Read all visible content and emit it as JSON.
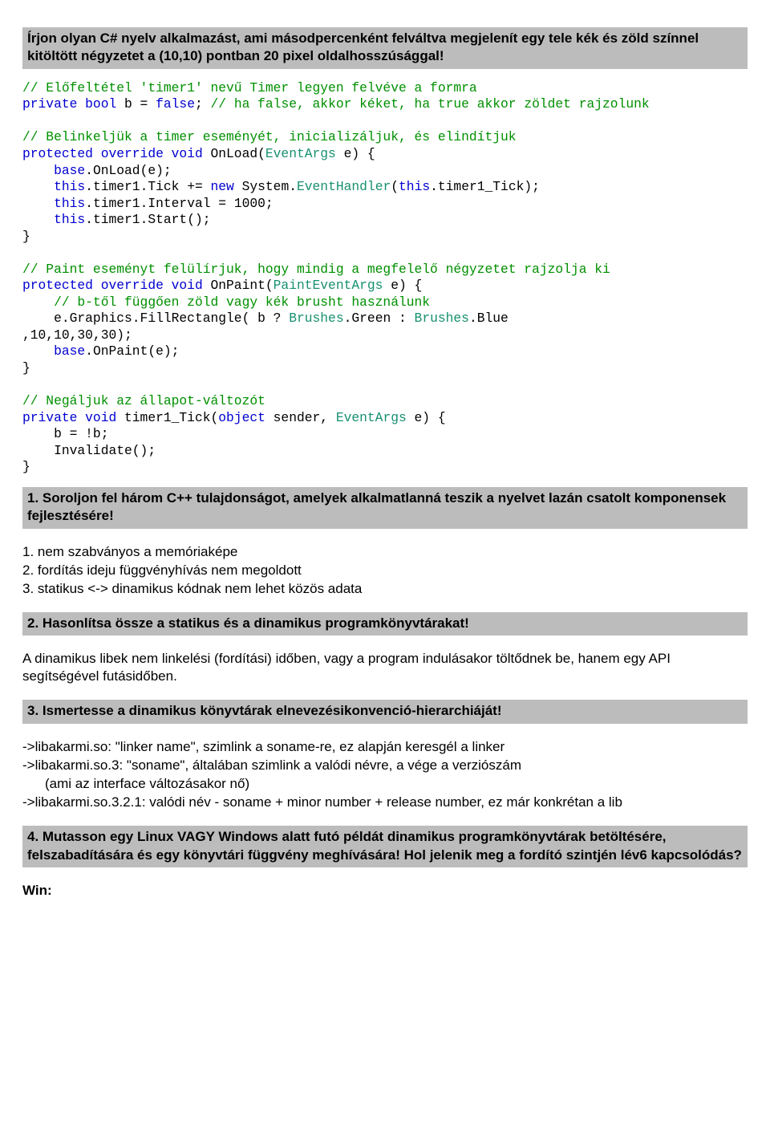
{
  "q1": {
    "title": "Írjon olyan C# nyelv alkalmazást, ami másodpercenként felváltva megjelenít egy tele kék és zöld színnel kitöltött négyzetet a (10,10) pontban 20 pixel oldalhosszúsággal!"
  },
  "code1": {
    "c1a": "// Előfeltétel 'timer1' nevű Timer legyen felvéve a formra",
    "c1b_pre": "private bool",
    "c1b_mid": " b = ",
    "c1b_false": "false",
    "c1b_post": "; ",
    "c1c": "// ha false, akkor kéket, ha true akkor zöldet rajzolunk",
    "c2": "// Belinkeljük a timer eseményét, inicializáljuk, és elindítjuk",
    "c3a": "protected override void",
    "c3b": " OnLoad(",
    "c3c": "EventArgs",
    "c3d": " e) {",
    "c4a": "    ",
    "c4b": "base",
    "c4c": ".OnLoad(e);",
    "c5a": "    ",
    "c5b": "this",
    "c5c": ".timer1.Tick += ",
    "c5d": "new",
    "c5e": " System.",
    "c5f": "EventHandler",
    "c5g": "(",
    "c5h": "this",
    "c5i": ".timer1_Tick);",
    "c6a": "    ",
    "c6b": "this",
    "c6c": ".timer1.Interval = 1000;",
    "c7a": "    ",
    "c7b": "this",
    "c7c": ".timer1.Start();",
    "c8": "}",
    "c9": "// Paint eseményt felülírjuk, hogy mindig a megfelelő négyzetet rajzolja ki",
    "c10a": "protected override void",
    "c10b": " OnPaint(",
    "c10c": "PaintEventArgs",
    "c10d": " e) {",
    "c11": "    // b-től függően zöld vagy kék brusht használunk",
    "c12a": "    e.Graphics.FillRectangle( b ? ",
    "c12b": "Brushes",
    "c12c": ".Green : ",
    "c12d": "Brushes",
    "c12e": ".Blue",
    "c12f": ",10,10,30,30);",
    "c13a": "    ",
    "c13b": "base",
    "c13c": ".OnPaint(e);",
    "c14": "}",
    "c15": "// Negáljuk az állapot-változót",
    "c16a": "private void",
    "c16b": " timer1_Tick(",
    "c16c": "object",
    "c16d": " sender, ",
    "c16e": "EventArgs",
    "c16f": " e) {",
    "c17": "    b = !b;",
    "c18": "    Invalidate();",
    "c19": "}"
  },
  "q2": {
    "title": "1. Soroljon fel három C++ tulajdonságot, amelyek alkalmatlanná teszik a nyelvet lazán csatolt komponensek fejlesztésére!",
    "a1": " 1. nem szabványos a memóriaképe",
    "a2": " 2. fordítás ideju függvényhívás nem megoldott",
    "a3": " 3. statikus <-> dinamikus kódnak nem lehet közös adata"
  },
  "q3": {
    "title": "2. Hasonlítsa össze a statikus és a dinamikus programkönyvtárakat!",
    "a": "A dinamikus libek nem linkelési (fordítási) időben, vagy a program indulásakor töltődnek be, hanem egy API segítségével futásidőben."
  },
  "q4": {
    "title": "3. Ismertesse a dinamikus könyvtárak elnevezésikonvenció-hierarchiáját!",
    "l1": "->libakarmi.so: \"linker name\", szimlink a soname-re, ez alapján keresgél a linker",
    "l2": "->libakarmi.so.3: \"soname\", általában szimlink a valódi névre, a vége a verziószám",
    "l3": "(ami az interface változásakor nő)",
    "l4": "->libakarmi.so.3.2.1: valódi név - soname + minor number + release number, ez már konkrétan a lib"
  },
  "q5": {
    "title": "4. Mutasson egy Linux VAGY Windows alatt futó példát dinamikus programkönyvtárak betöltésére, felszabadítására és egy könyvtári függvény meghívására! Hol jelenik meg a fordító szintjén lév6 kapcsolódás?",
    "win": "Win:"
  }
}
